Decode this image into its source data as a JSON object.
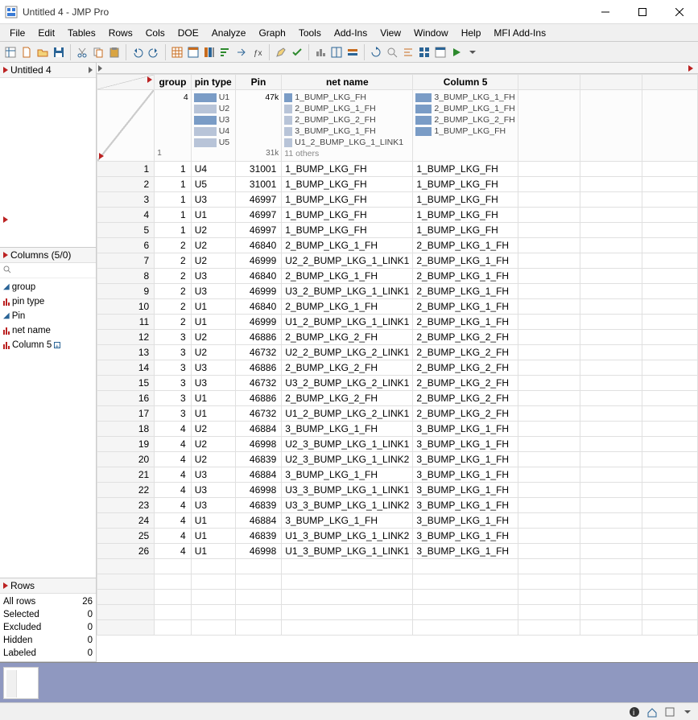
{
  "window": {
    "title": "Untitled 4 - JMP Pro"
  },
  "menu": [
    "File",
    "Edit",
    "Tables",
    "Rows",
    "Cols",
    "DOE",
    "Analyze",
    "Graph",
    "Tools",
    "Add-Ins",
    "View",
    "Window",
    "Help",
    "MFI Add-Ins"
  ],
  "panels": {
    "tables": {
      "title": "Untitled 4"
    },
    "columns": {
      "title": "Columns (5/0)",
      "items": [
        {
          "name": "group",
          "type": "continuous"
        },
        {
          "name": "pin type",
          "type": "nominal"
        },
        {
          "name": "Pin",
          "type": "continuous"
        },
        {
          "name": "net name",
          "type": "nominal"
        },
        {
          "name": "Column 5",
          "type": "nominal",
          "extra": true
        }
      ]
    },
    "rows": {
      "title": "Rows",
      "stats": [
        {
          "label": "All rows",
          "value": 26
        },
        {
          "label": "Selected",
          "value": 0
        },
        {
          "label": "Excluded",
          "value": 0
        },
        {
          "label": "Hidden",
          "value": 0
        },
        {
          "label": "Labeled",
          "value": 0
        }
      ]
    }
  },
  "columns": [
    "group",
    "pin type",
    "Pin",
    "net name",
    "Column 5"
  ],
  "summary": {
    "group": {
      "right": "4",
      "bottomLeft": "1"
    },
    "pintype": {
      "items": [
        {
          "label": "U1",
          "sel": true
        },
        {
          "label": "U2",
          "sel": false
        },
        {
          "label": "U3",
          "sel": true
        },
        {
          "label": "U4",
          "sel": false
        },
        {
          "label": "U5",
          "sel": false
        }
      ]
    },
    "pin": {
      "right": "47k",
      "bottom": "31k"
    },
    "netname": {
      "items": [
        {
          "label": "1_BUMP_LKG_FH",
          "sel": true
        },
        {
          "label": "2_BUMP_LKG_1_FH",
          "sel": false
        },
        {
          "label": "2_BUMP_LKG_2_FH",
          "sel": false
        },
        {
          "label": "3_BUMP_LKG_1_FH",
          "sel": false
        },
        {
          "label": "U1_2_BUMP_LKG_1_LINK1",
          "sel": false
        },
        {
          "label": "11 others",
          "sel": false,
          "others": true
        }
      ]
    },
    "col5": {
      "items": [
        {
          "label": "3_BUMP_LKG_1_FH",
          "sel": true
        },
        {
          "label": "2_BUMP_LKG_1_FH",
          "sel": true
        },
        {
          "label": "2_BUMP_LKG_2_FH",
          "sel": true
        },
        {
          "label": "1_BUMP_LKG_FH",
          "sel": true
        }
      ]
    }
  },
  "rows": [
    {
      "n": 1,
      "group": 1,
      "pintype": "U4",
      "pin": 31001,
      "net": "1_BUMP_LKG_FH",
      "c5": "1_BUMP_LKG_FH"
    },
    {
      "n": 2,
      "group": 1,
      "pintype": "U5",
      "pin": 31001,
      "net": "1_BUMP_LKG_FH",
      "c5": "1_BUMP_LKG_FH"
    },
    {
      "n": 3,
      "group": 1,
      "pintype": "U3",
      "pin": 46997,
      "net": "1_BUMP_LKG_FH",
      "c5": "1_BUMP_LKG_FH"
    },
    {
      "n": 4,
      "group": 1,
      "pintype": "U1",
      "pin": 46997,
      "net": "1_BUMP_LKG_FH",
      "c5": "1_BUMP_LKG_FH"
    },
    {
      "n": 5,
      "group": 1,
      "pintype": "U2",
      "pin": 46997,
      "net": "1_BUMP_LKG_FH",
      "c5": "1_BUMP_LKG_FH"
    },
    {
      "n": 6,
      "group": 2,
      "pintype": "U2",
      "pin": 46840,
      "net": "2_BUMP_LKG_1_FH",
      "c5": "2_BUMP_LKG_1_FH"
    },
    {
      "n": 7,
      "group": 2,
      "pintype": "U2",
      "pin": 46999,
      "net": "U2_2_BUMP_LKG_1_LINK1",
      "c5": "2_BUMP_LKG_1_FH"
    },
    {
      "n": 8,
      "group": 2,
      "pintype": "U3",
      "pin": 46840,
      "net": "2_BUMP_LKG_1_FH",
      "c5": "2_BUMP_LKG_1_FH"
    },
    {
      "n": 9,
      "group": 2,
      "pintype": "U3",
      "pin": 46999,
      "net": "U3_2_BUMP_LKG_1_LINK1",
      "c5": "2_BUMP_LKG_1_FH"
    },
    {
      "n": 10,
      "group": 2,
      "pintype": "U1",
      "pin": 46840,
      "net": "2_BUMP_LKG_1_FH",
      "c5": "2_BUMP_LKG_1_FH"
    },
    {
      "n": 11,
      "group": 2,
      "pintype": "U1",
      "pin": 46999,
      "net": "U1_2_BUMP_LKG_1_LINK1",
      "c5": "2_BUMP_LKG_1_FH"
    },
    {
      "n": 12,
      "group": 3,
      "pintype": "U2",
      "pin": 46886,
      "net": "2_BUMP_LKG_2_FH",
      "c5": "2_BUMP_LKG_2_FH"
    },
    {
      "n": 13,
      "group": 3,
      "pintype": "U2",
      "pin": 46732,
      "net": "U2_2_BUMP_LKG_2_LINK1",
      "c5": "2_BUMP_LKG_2_FH"
    },
    {
      "n": 14,
      "group": 3,
      "pintype": "U3",
      "pin": 46886,
      "net": "2_BUMP_LKG_2_FH",
      "c5": "2_BUMP_LKG_2_FH"
    },
    {
      "n": 15,
      "group": 3,
      "pintype": "U3",
      "pin": 46732,
      "net": "U3_2_BUMP_LKG_2_LINK1",
      "c5": "2_BUMP_LKG_2_FH"
    },
    {
      "n": 16,
      "group": 3,
      "pintype": "U1",
      "pin": 46886,
      "net": "2_BUMP_LKG_2_FH",
      "c5": "2_BUMP_LKG_2_FH"
    },
    {
      "n": 17,
      "group": 3,
      "pintype": "U1",
      "pin": 46732,
      "net": "U1_2_BUMP_LKG_2_LINK1",
      "c5": "2_BUMP_LKG_2_FH"
    },
    {
      "n": 18,
      "group": 4,
      "pintype": "U2",
      "pin": 46884,
      "net": "3_BUMP_LKG_1_FH",
      "c5": "3_BUMP_LKG_1_FH"
    },
    {
      "n": 19,
      "group": 4,
      "pintype": "U2",
      "pin": 46998,
      "net": "U2_3_BUMP_LKG_1_LINK1",
      "c5": "3_BUMP_LKG_1_FH"
    },
    {
      "n": 20,
      "group": 4,
      "pintype": "U2",
      "pin": 46839,
      "net": "U2_3_BUMP_LKG_1_LINK2",
      "c5": "3_BUMP_LKG_1_FH"
    },
    {
      "n": 21,
      "group": 4,
      "pintype": "U3",
      "pin": 46884,
      "net": "3_BUMP_LKG_1_FH",
      "c5": "3_BUMP_LKG_1_FH"
    },
    {
      "n": 22,
      "group": 4,
      "pintype": "U3",
      "pin": 46998,
      "net": "U3_3_BUMP_LKG_1_LINK1",
      "c5": "3_BUMP_LKG_1_FH"
    },
    {
      "n": 23,
      "group": 4,
      "pintype": "U3",
      "pin": 46839,
      "net": "U3_3_BUMP_LKG_1_LINK2",
      "c5": "3_BUMP_LKG_1_FH"
    },
    {
      "n": 24,
      "group": 4,
      "pintype": "U1",
      "pin": 46884,
      "net": "3_BUMP_LKG_1_FH",
      "c5": "3_BUMP_LKG_1_FH"
    },
    {
      "n": 25,
      "group": 4,
      "pintype": "U1",
      "pin": 46839,
      "net": "U1_3_BUMP_LKG_1_LINK2",
      "c5": "3_BUMP_LKG_1_FH"
    },
    {
      "n": 26,
      "group": 4,
      "pintype": "U1",
      "pin": 46998,
      "net": "U1_3_BUMP_LKG_1_LINK1",
      "c5": "3_BUMP_LKG_1_FH"
    }
  ],
  "colwidths": {
    "rownum": 60,
    "group": 46,
    "pintype": 55,
    "pin": 60,
    "net": 145,
    "c5": 130,
    "blank1": 90,
    "blank2": 90,
    "blank3": 80
  }
}
